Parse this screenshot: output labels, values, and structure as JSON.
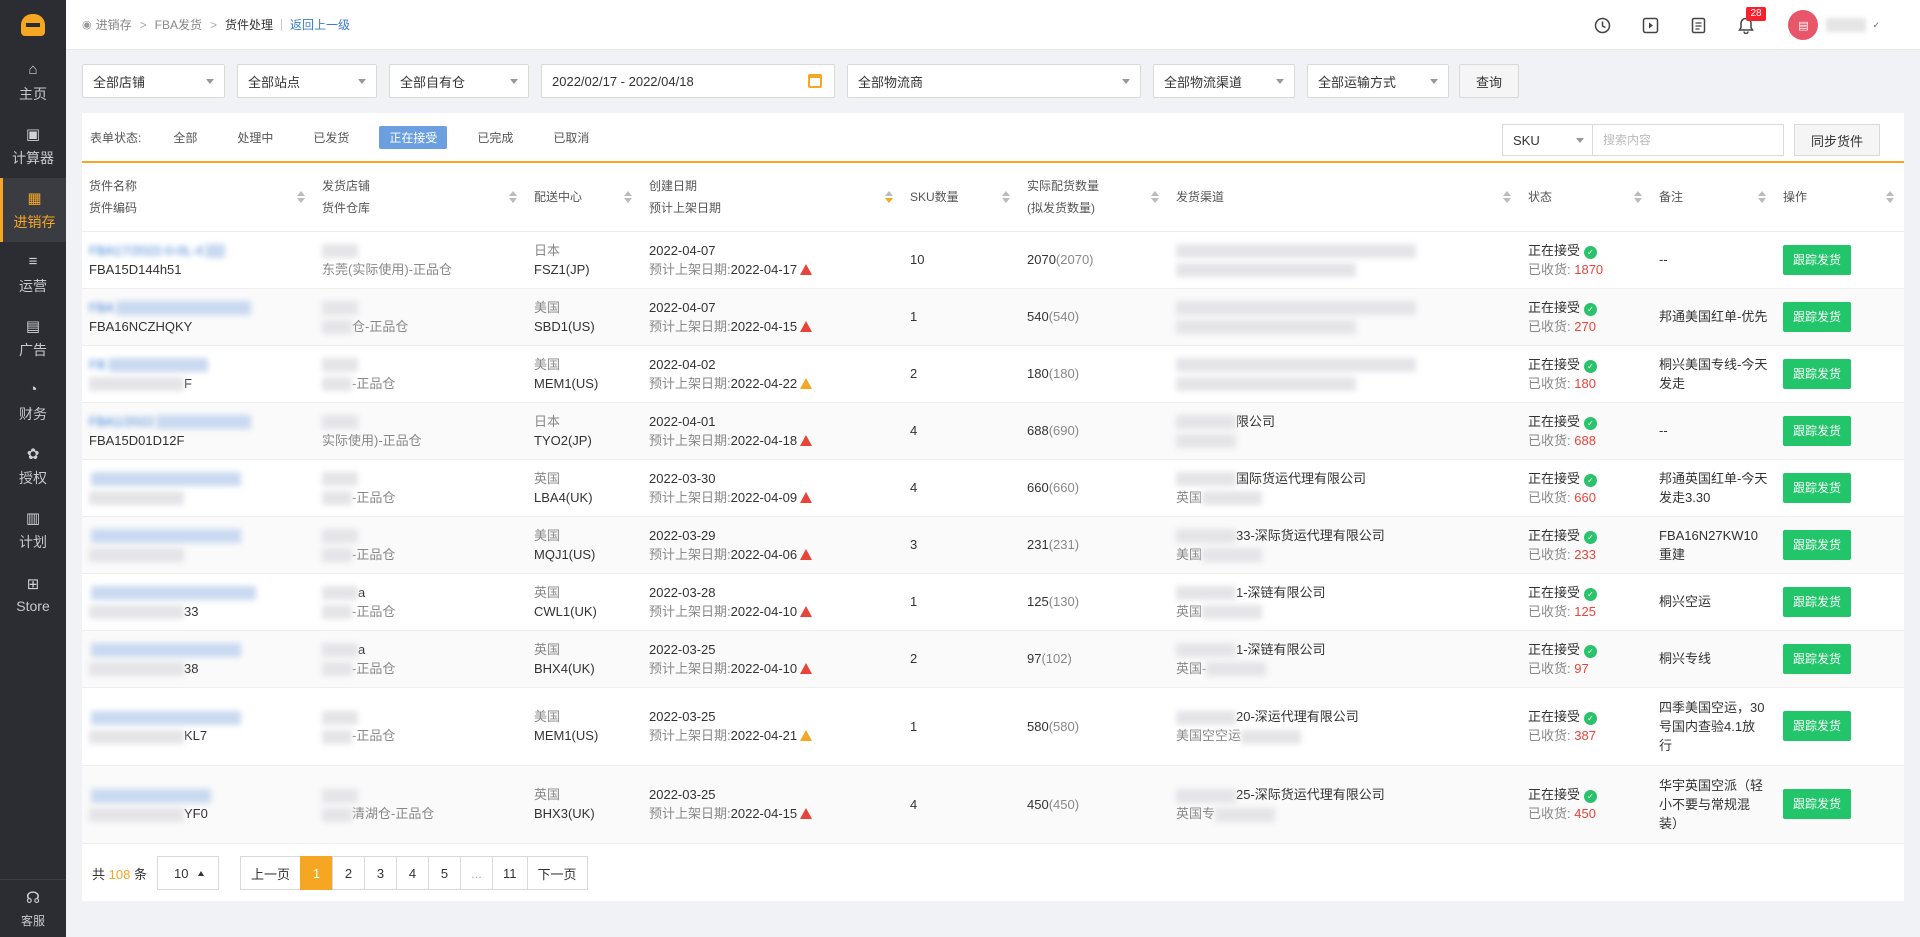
{
  "sidebar": {
    "items": [
      {
        "label": "主页",
        "icon": "home-icon",
        "glyph": "⌂",
        "active": false
      },
      {
        "label": "计算器",
        "icon": "calculator-icon",
        "glyph": "▣",
        "active": false
      },
      {
        "label": "进销存",
        "icon": "inventory-icon",
        "glyph": "▦",
        "active": true
      },
      {
        "label": "运营",
        "icon": "operations-icon",
        "glyph": "≡",
        "active": false
      },
      {
        "label": "广告",
        "icon": "ads-icon",
        "glyph": "▤",
        "active": false
      },
      {
        "label": "财务",
        "icon": "finance-icon",
        "glyph": "◔",
        "active": false
      },
      {
        "label": "授权",
        "icon": "authorize-icon",
        "glyph": "✿",
        "active": false
      },
      {
        "label": "计划",
        "icon": "plan-icon",
        "glyph": "▥",
        "active": false
      },
      {
        "label": "Store",
        "icon": "store-icon",
        "glyph": "⊞",
        "active": false
      }
    ],
    "service_label": "客服"
  },
  "breadcrumb": {
    "items": [
      "进销存",
      "FBA发货",
      "货件处理"
    ],
    "back_label": "返回上一级"
  },
  "topbar": {
    "notification_count": "28"
  },
  "filters": {
    "shop": "全部店铺",
    "site": "全部站点",
    "warehouse": "全部自有仓",
    "date_range": "2022/02/17 - 2022/04/18",
    "carrier": "全部物流商",
    "channel": "全部物流渠道",
    "transport": "全部运输方式",
    "query_label": "查询"
  },
  "status_bar": {
    "label": "表单状态:",
    "tabs": [
      {
        "label": "全部",
        "active": false
      },
      {
        "label": "处理中",
        "active": false
      },
      {
        "label": "已发货",
        "active": false
      },
      {
        "label": "正在接受",
        "active": true
      },
      {
        "label": "已完成",
        "active": false
      },
      {
        "label": "已取消",
        "active": false
      }
    ],
    "search_type": "SKU",
    "search_placeholder": "搜索内容",
    "sync_label": "同步货件"
  },
  "table": {
    "headers": {
      "name": "货件名称",
      "code": "货件编码",
      "shop": "发货店铺",
      "warehouse": "货件仓库",
      "center": "配送中心",
      "created": "创建日期",
      "eta": "预计上架日期",
      "sku": "SKU数量",
      "qty": "实际配货数量",
      "qty_sub": "(拟发货数量)",
      "channel": "发货渠道",
      "status": "状态",
      "note": "备注",
      "op": "操作"
    },
    "eta_prefix": "预计上架日期:",
    "received_prefix": "已收货:",
    "status_label": "正在接受",
    "op_label": "跟踪发货",
    "rows": [
      {
        "name": "FBA17/2022-0-0L-4",
        "code": "FBA15D144h51",
        "shop": "",
        "warehouse": "东莞(实际使用)-正品仓",
        "country": "日本",
        "fc": "FSZ1(JP)",
        "created": "2022-04-07",
        "eta": "2022-04-17",
        "warn": "red",
        "sku": "10",
        "qty": "2070",
        "plan": "(2070)",
        "ch1": "",
        "ch2": "",
        "received": "1870",
        "note": "--"
      },
      {
        "name": "FBA",
        "code": "FBA16NCZHQKY",
        "shop": "",
        "warehouse": "仓-正品仓",
        "country": "美国",
        "fc": "SBD1(US)",
        "created": "2022-04-07",
        "eta": "2022-04-15",
        "warn": "red",
        "sku": "1",
        "qty": "540",
        "plan": "(540)",
        "ch1": "",
        "ch2": "",
        "received": "270",
        "note": "邦通美国红单-优先"
      },
      {
        "name": "FB",
        "code": "F",
        "shop": "",
        "warehouse": "-正品仓",
        "country": "美国",
        "fc": "MEM1(US)",
        "created": "2022-04-02",
        "eta": "2022-04-22",
        "warn": "orange",
        "sku": "2",
        "qty": "180",
        "plan": "(180)",
        "ch1": "",
        "ch2": "",
        "received": "180",
        "note": "桐兴美国专线-今天发走"
      },
      {
        "name": "FBA1/2022",
        "code": "FBA15D01D12F",
        "shop": "",
        "warehouse": "实际使用)-正品仓",
        "country": "日本",
        "fc": "TYO2(JP)",
        "created": "2022-04-01",
        "eta": "2022-04-18",
        "warn": "red",
        "sku": "4",
        "qty": "688",
        "plan": "(690)",
        "ch1": "限公司",
        "ch2": "",
        "received": "688",
        "note": "--"
      },
      {
        "name": "",
        "code": "",
        "shop": "",
        "warehouse": "-正品仓",
        "country": "英国",
        "fc": "LBA4(UK)",
        "created": "2022-03-30",
        "eta": "2022-04-09",
        "warn": "red",
        "sku": "4",
        "qty": "660",
        "plan": "(660)",
        "ch1": "国际货运代理有限公司",
        "ch2": "英国",
        "received": "660",
        "note": "邦通英国红单-今天发走3.30"
      },
      {
        "name": "",
        "code": "",
        "shop": "",
        "warehouse": "-正品仓",
        "country": "美国",
        "fc": "MQJ1(US)",
        "created": "2022-03-29",
        "eta": "2022-04-06",
        "warn": "red",
        "sku": "3",
        "qty": "231",
        "plan": "(231)",
        "ch1": "33-深际货运代理有限公司",
        "ch2": "美国",
        "received": "233",
        "note": "FBA16N27KW10重建"
      },
      {
        "name": "",
        "code": "33",
        "shop": "a",
        "warehouse": "-正品仓",
        "country": "英国",
        "fc": "CWL1(UK)",
        "created": "2022-03-28",
        "eta": "2022-04-10",
        "warn": "red",
        "sku": "1",
        "qty": "125",
        "plan": "(130)",
        "ch1": "1-深链有限公司",
        "ch2": "英国",
        "received": "125",
        "note": "桐兴空运"
      },
      {
        "name": "",
        "code": "38",
        "shop": "a",
        "warehouse": "-正品仓",
        "country": "英国",
        "fc": "BHX4(UK)",
        "created": "2022-03-25",
        "eta": "2022-04-10",
        "warn": "red",
        "sku": "2",
        "qty": "97",
        "plan": "(102)",
        "ch1": "1-深链有限公司",
        "ch2": "英国-",
        "received": "97",
        "note": "桐兴专线"
      },
      {
        "name": "",
        "code": "KL7",
        "shop": "",
        "warehouse": "-正品仓",
        "country": "美国",
        "fc": "MEM1(US)",
        "created": "2022-03-25",
        "eta": "2022-04-21",
        "warn": "orange",
        "sku": "1",
        "qty": "580",
        "plan": "(580)",
        "ch1": "20-深运代理有限公司",
        "ch2": "美国空空运",
        "received": "387",
        "note": "四季美国空运，30号国内查验4.1放行"
      },
      {
        "name": "",
        "code": "YF0",
        "shop": "",
        "warehouse": "清湖仓-正品仓",
        "country": "英国",
        "fc": "BHX3(UK)",
        "created": "2022-03-25",
        "eta": "2022-04-15",
        "warn": "red",
        "sku": "4",
        "qty": "450",
        "plan": "(450)",
        "ch1": "25-深际货运代理有限公司",
        "ch2": "英国专",
        "received": "450",
        "note": "华宇英国空派（轻小不要与常规混装）"
      }
    ]
  },
  "pagination": {
    "total_prefix": "共",
    "total": "108",
    "total_suffix": "条",
    "page_size": "10",
    "prev": "上一页",
    "next": "下一页",
    "pages": [
      "1",
      "2",
      "3",
      "4",
      "5",
      "...",
      "11"
    ],
    "current": "1"
  }
}
